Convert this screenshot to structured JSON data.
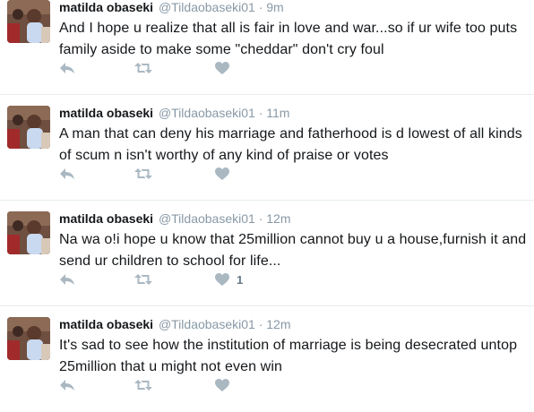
{
  "colors": {
    "name": "#14171a",
    "meta": "#8899a6",
    "action_icon": "#aab8c2",
    "divider": "#e6ecf0"
  },
  "tweets": [
    {
      "fullname": "matilda obaseki",
      "username": "@Tildaobaseki01",
      "separator": "·",
      "time": "9m",
      "text": "And I hope u realize that all is fair in love and war...so if ur wife too puts family aside to make some \"cheddar\" don't cry foul",
      "actions": {
        "reply_icon": "reply-icon",
        "retweet_icon": "retweet-icon",
        "like_icon": "heart-icon",
        "like_count": ""
      }
    },
    {
      "fullname": "matilda obaseki",
      "username": "@Tildaobaseki01",
      "separator": "·",
      "time": "11m",
      "text": "A man that can deny his marriage and fatherhood is d lowest of all kinds of scum n isn't worthy of any kind of praise or votes",
      "actions": {
        "reply_icon": "reply-icon",
        "retweet_icon": "retweet-icon",
        "like_icon": "heart-icon",
        "like_count": ""
      }
    },
    {
      "fullname": "matilda obaseki",
      "username": "@Tildaobaseki01",
      "separator": "·",
      "time": "12m",
      "text": "Na wa o!i hope u know that 25million cannot buy u a house,furnish it and send ur children to school for life...",
      "actions": {
        "reply_icon": "reply-icon",
        "retweet_icon": "retweet-icon",
        "like_icon": "heart-icon",
        "like_count": "1"
      }
    },
    {
      "fullname": "matilda obaseki",
      "username": "@Tildaobaseki01",
      "separator": "·",
      "time": "12m",
      "text": "It's sad to see how the institution of marriage is being desecrated untop 25million that u might not even win",
      "actions": {
        "reply_icon": "reply-icon",
        "retweet_icon": "retweet-icon",
        "like_icon": "heart-icon",
        "like_count": ""
      }
    }
  ]
}
